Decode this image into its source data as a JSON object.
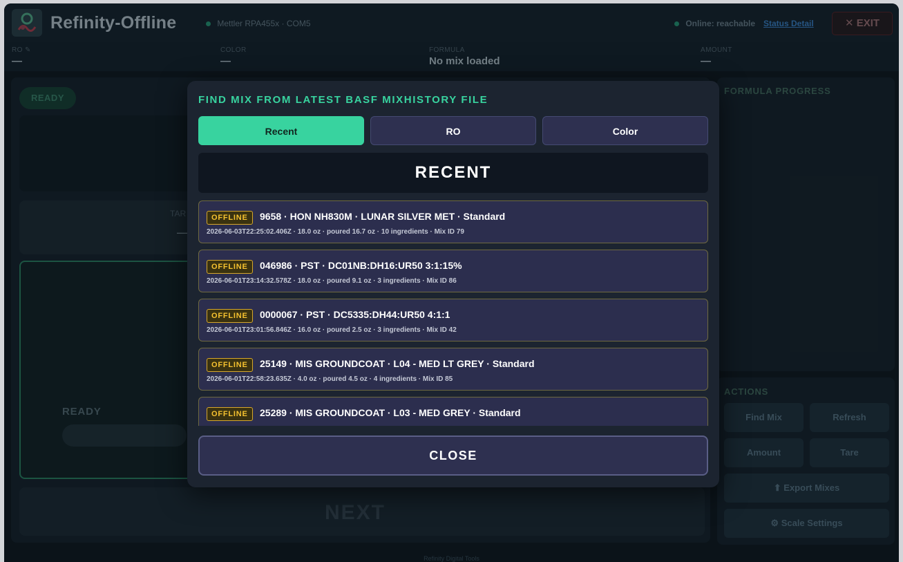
{
  "header": {
    "title": "Refinity-Offline",
    "scale_status": "Mettler RPA455x · COM5",
    "online_status": "Online: reachable",
    "status_link": "Status Detail",
    "exit_label": "EXIT",
    "exit_icon": "x-icon"
  },
  "infobar": {
    "ro_label": "RO",
    "ro_value": "—",
    "color_label": "COLOR",
    "color_value": "—",
    "formula_label": "FORMULA",
    "formula_value": "No mix loaded",
    "amount_label": "AMOUNT",
    "amount_value": "—"
  },
  "background": {
    "ready_pill": "READY",
    "tare_label": "TAR",
    "tare_value": "—",
    "ready_label": "READY",
    "next_label": "NEXT",
    "formula_progress": "FORMULA PROGRESS",
    "actions_label": "ACTIONS",
    "find_mix": "Find Mix",
    "refresh": "Refresh",
    "amount": "Amount",
    "tare": "Tare",
    "export_mixes": "⬆ Export Mixes",
    "scale_settings": "⚙ Scale Settings",
    "footer": "Refinity Digital Tools"
  },
  "modal": {
    "title": "FIND MIX FROM LATEST BASF MIXHISTORY FILE",
    "tabs": [
      {
        "label": "Recent",
        "active": true
      },
      {
        "label": "RO",
        "active": false
      },
      {
        "label": "Color",
        "active": false
      }
    ],
    "section_heading": "RECENT",
    "items": [
      {
        "badge": "OFFLINE",
        "title": "9658 · HON NH830M · LUNAR SILVER MET · Standard",
        "subtitle": "2026-06-03T22:25:02.406Z · 18.0 oz · poured 16.7 oz · 10 ingredients · Mix ID 79"
      },
      {
        "badge": "OFFLINE",
        "title": "046986 · PST · DC01NB:DH16:UR50 3:1:15%",
        "subtitle": "2026-06-01T23:14:32.578Z · 18.0 oz · poured 9.1 oz · 3 ingredients · Mix ID 86"
      },
      {
        "badge": "OFFLINE",
        "title": "0000067 · PST · DC5335:DH44:UR50 4:1:1",
        "subtitle": "2026-06-01T23:01:56.846Z · 16.0 oz · poured 2.5 oz · 3 ingredients · Mix ID 42"
      },
      {
        "badge": "OFFLINE",
        "title": "25149 · MIS GROUNDCOAT · L04 - MED LT GREY · Standard",
        "subtitle": "2026-06-01T22:58:23.635Z · 4.0 oz · poured 4.5 oz · 4 ingredients · Mix ID 85"
      },
      {
        "badge": "OFFLINE",
        "title": "25289 · MIS GROUNDCOAT · L03 - MED GREY · Standard",
        "subtitle": ""
      }
    ],
    "close_label": "CLOSE"
  },
  "colors": {
    "accent": "#38d39f",
    "badge": "#f6c230",
    "modal_bg": "#1c2430"
  }
}
